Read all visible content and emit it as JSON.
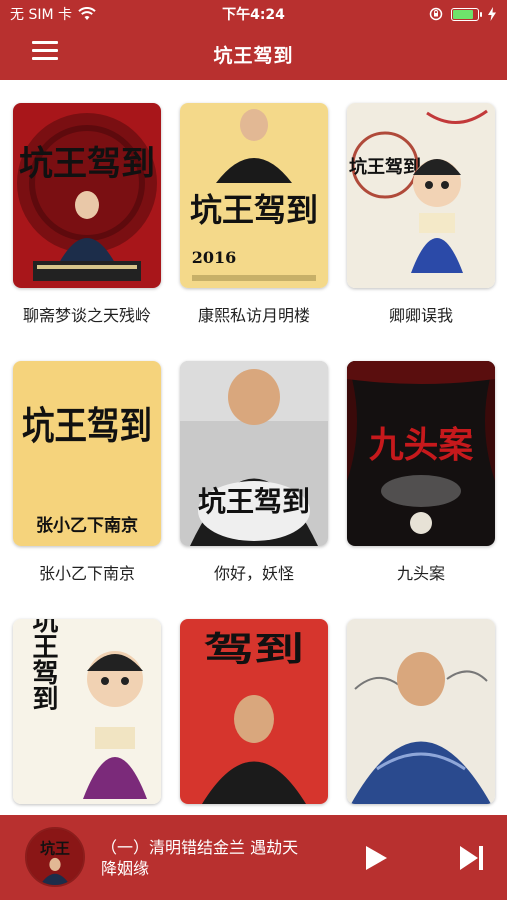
{
  "status_bar": {
    "carrier": "无 SIM 卡",
    "time": "下午4:24",
    "wifi_icon": "wifi-icon",
    "orientation_lock_icon": "orientation-lock-icon",
    "charging_icon": "charging-bolt-icon",
    "battery_level": 0.85
  },
  "nav": {
    "title": "坑王驾到",
    "menu_icon": "hamburger-menu-icon"
  },
  "albums": [
    {
      "title": "聊斋梦谈之天残岭",
      "cover_text": "坑王驾到",
      "cover_year": ""
    },
    {
      "title": "康熙私访月明楼",
      "cover_text": "坑王驾到",
      "cover_year": "2016"
    },
    {
      "title": "卿卿误我",
      "cover_text": "坑王驾到",
      "cover_year": ""
    },
    {
      "title": "张小乙下南京",
      "cover_text": "坑王驾到",
      "cover_year": "张小乙下南京"
    },
    {
      "title": "你好，妖怪",
      "cover_text": "坑王驾到",
      "cover_year": ""
    },
    {
      "title": "九头案",
      "cover_text": "九头案",
      "cover_year": ""
    },
    {
      "title": "",
      "cover_text": "坑王驾到",
      "cover_year": ""
    },
    {
      "title": "",
      "cover_text": "驾到",
      "cover_year": ""
    },
    {
      "title": "",
      "cover_text": "",
      "cover_year": ""
    }
  ],
  "player": {
    "track_title": "（一）清明错结金兰 遇劫天降姻缘",
    "art_text": "坑王",
    "play_icon": "play-icon",
    "next_icon": "skip-next-icon"
  },
  "colors": {
    "brand_red": "#b8302f",
    "background": "#ffffff"
  }
}
